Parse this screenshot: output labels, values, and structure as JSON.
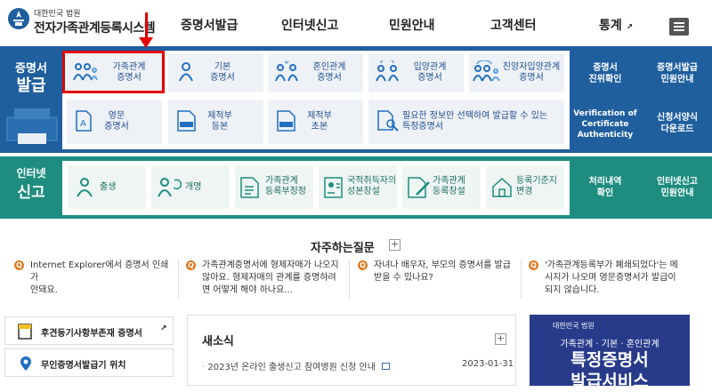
{
  "header": {
    "logo_small": "대한민국 법원",
    "logo_title": "전자가족관계등록시스템",
    "nav": [
      "증명서발급",
      "인터넷신고",
      "민원안내",
      "고객센터",
      "통계"
    ]
  },
  "issue": {
    "label_top": "증명서",
    "label_bottom": "발급",
    "cards_row1": [
      {
        "l1": "가족관계",
        "l2": "증명서"
      },
      {
        "l1": "기본",
        "l2": "증명서"
      },
      {
        "l1": "혼인관계",
        "l2": "증명서"
      },
      {
        "l1": "입양관계",
        "l2": "증명서"
      },
      {
        "l1": "친양자입양관계",
        "l2": "증명서"
      }
    ],
    "cards_row2": [
      {
        "l1": "영문",
        "l2": "증명서"
      },
      {
        "l1": "제적부",
        "l2": "등본"
      },
      {
        "l1": "제적부",
        "l2": "초본"
      },
      {
        "l1": "필요한 정보만 선택하여 발급할 수 있는",
        "l2": "특정증명서"
      }
    ],
    "side": [
      {
        "l1": "증명서",
        "l2": "진위확인"
      },
      {
        "l1": "증명서발급",
        "l2": "민원안내"
      },
      {
        "l1": "Verification of",
        "l2": "Certificate",
        "l3": "Authenticity"
      },
      {
        "l1": "신청서양식",
        "l2": "다운로드"
      }
    ]
  },
  "report": {
    "label_top": "인터넷",
    "label_bottom": "신고",
    "cards": [
      {
        "l1": "출생",
        "l2": ""
      },
      {
        "l1": "개명",
        "l2": ""
      },
      {
        "l1": "가족관계",
        "l2": "등록부정정"
      },
      {
        "l1": "국적취득자의",
        "l2": "성본창설"
      },
      {
        "l1": "가족관계",
        "l2": "등록창설"
      },
      {
        "l1": "등록기준지",
        "l2": "변경"
      }
    ],
    "side": [
      {
        "l1": "처리내역",
        "l2": "확인"
      },
      {
        "l1": "인터넷신고",
        "l2": "민원안내"
      }
    ]
  },
  "faq": {
    "title": "자주하는질문",
    "items": [
      {
        "l1": "Internet Explorer에서 증명서 인쇄가",
        "l2": "안돼요.",
        "l3": ""
      },
      {
        "l1": "가족관계증명서에 형제자매가 나오지",
        "l2": "않아요. 형제자매의 관계를 증명하려",
        "l3": "면 어떻게 해야 하나요..."
      },
      {
        "l1": "자녀나 배우자, 부모의 증명서를 발급",
        "l2": "받을 수 있나요?",
        "l3": ""
      },
      {
        "l1": "'가족관계등록부가 폐쇄되었다'는 메",
        "l2": "시지가 나오며 영문증명서가 발급이",
        "l3": "되지 않습니다."
      }
    ]
  },
  "links": {
    "l1": "후견등기사항부존재 증명서",
    "l2": "무인증명서발급기 위치"
  },
  "news": {
    "title": "새소식",
    "item": "2023년 온라인 출생신고 참여병원 신청 안내",
    "date": "2023-01-31"
  },
  "banner": {
    "small": "대한민국 법원",
    "sub": "가족관계 · 기본 · 혼인관계",
    "big": "특정증명서",
    "big2": "발급서비스"
  }
}
